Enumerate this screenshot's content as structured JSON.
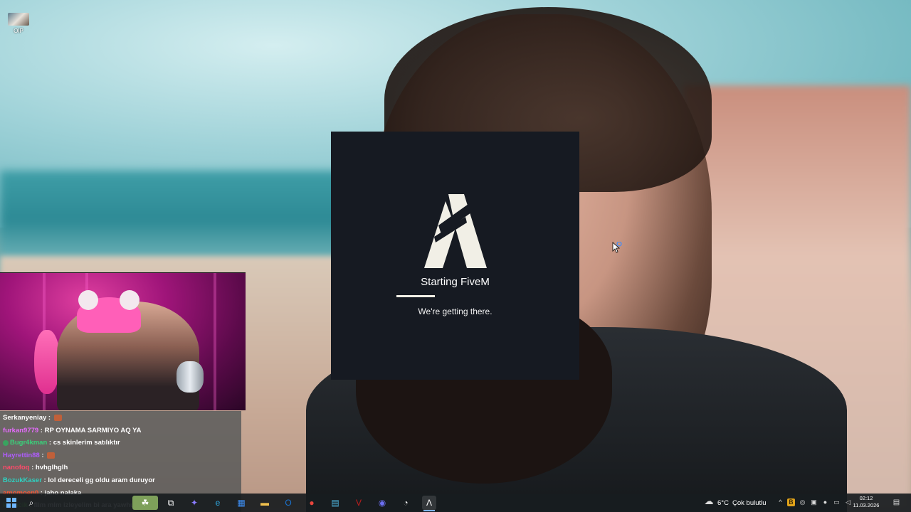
{
  "desktop": {
    "icon_label": "OIP"
  },
  "fivem": {
    "title": "Starting FiveM",
    "status": "We're getting there.",
    "progress": 0.4,
    "background_color": "#161a22",
    "logo_color": "#f1efe6"
  },
  "chat": {
    "messages": [
      {
        "user": "Serkanyeniay",
        "user_color": "#ffffff",
        "text": "",
        "emote": true,
        "badge": false
      },
      {
        "user": "furkan9779",
        "user_color": "#e66bff",
        "text": "RP OYNAMA SARMIYO AQ YA",
        "emote": false,
        "badge": false
      },
      {
        "user": "Bugr4kman",
        "user_color": "#3ad17a",
        "text": "cs skinlerim satılıktır",
        "emote": false,
        "badge": true
      },
      {
        "user": "Hayrettin88",
        "user_color": "#b05cff",
        "text": "",
        "emote": true,
        "badge": false
      },
      {
        "user": "nanofoq",
        "user_color": "#ff4a6a",
        "text": "hvhglhglh",
        "emote": false,
        "badge": false
      },
      {
        "user": "BozukKaser",
        "user_color": "#2fd0c0",
        "text": "lol dereceli gg oldu aram duruyor",
        "emote": false,
        "badge": false
      },
      {
        "user": "amomoen0",
        "user_color": "#ff5533",
        "text": "jaho nalaka",
        "emote": false,
        "badge": false
      },
      {
        "user": "kaancik",
        "user_color": "#7bff6a",
        "text": "film mlm izleyelim bi ara yawhu",
        "emote": false,
        "badge": false
      }
    ]
  },
  "taskbar": {
    "pinned": [
      {
        "name": "task-view-icon",
        "glyph": "⧉",
        "color": "#ffffff"
      },
      {
        "name": "copilot-icon",
        "glyph": "✦",
        "color": "#8a7bff"
      },
      {
        "name": "edge-icon",
        "glyph": "e",
        "color": "#2fa8e0"
      },
      {
        "name": "store-icon",
        "glyph": "▦",
        "color": "#3d8ff5"
      },
      {
        "name": "file-explorer-icon",
        "glyph": "▬",
        "color": "#f2c14e"
      },
      {
        "name": "outlook-icon",
        "glyph": "O",
        "color": "#1a73d1"
      },
      {
        "name": "chrome-icon",
        "glyph": "●",
        "color": "#e8453c"
      },
      {
        "name": "notepad-icon",
        "glyph": "▤",
        "color": "#4fb6e0"
      },
      {
        "name": "voice-meeter-icon",
        "glyph": "V",
        "color": "#c21d1d"
      },
      {
        "name": "discord-icon",
        "glyph": "◉",
        "color": "#6c6ff2"
      },
      {
        "name": "speedtest-icon",
        "glyph": "◔",
        "color": "#ffffff"
      },
      {
        "name": "fivem-icon",
        "glyph": "Λ",
        "color": "#ffffff"
      }
    ],
    "weather": {
      "temp": "6°C",
      "condition": "Çok bulutlu"
    },
    "clock": {
      "time": "02:12",
      "date": "11.03.2026"
    }
  }
}
